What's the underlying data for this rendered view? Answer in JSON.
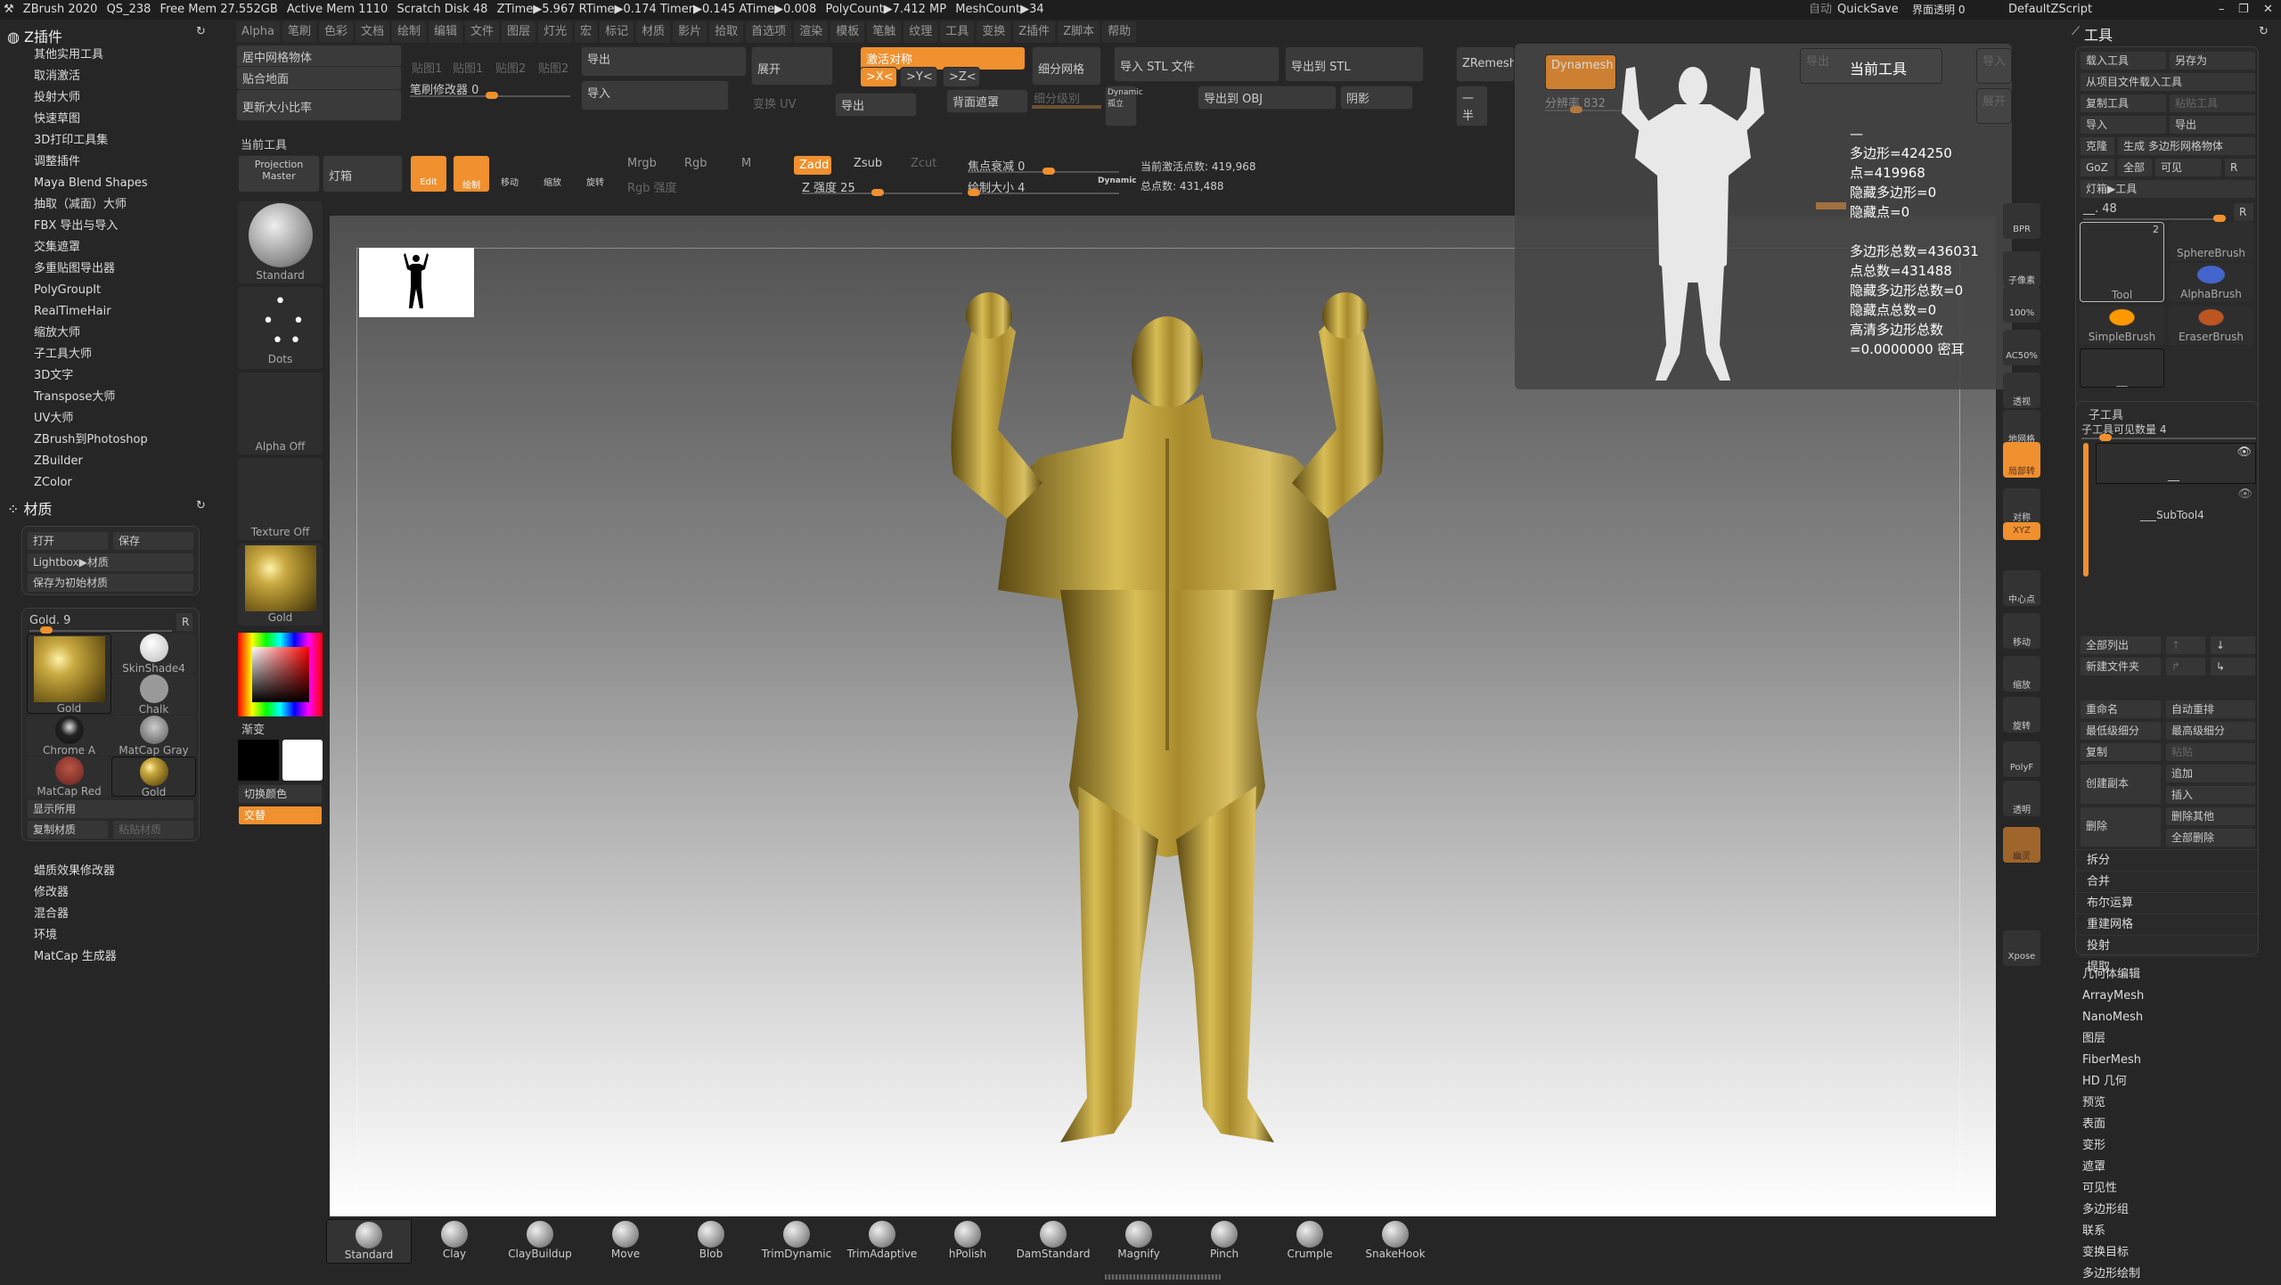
{
  "titlebar": {
    "app": "ZBrush 2020",
    "project": "QS_238",
    "free_mem": "Free Mem 27.552GB",
    "active_mem": "Active Mem 1110",
    "scratch": "Scratch Disk 48",
    "ztime": "ZTime▶5.967 RTime▶0.174 Timer▶0.145 ATime▶0.008",
    "polycount": "PolyCount▶7.412 MP",
    "meshcount": "MeshCount▶34",
    "auto": "自动",
    "quicksave": "QuickSave",
    "ui_opacity": "界面透明 0",
    "script": "DefaultZScript"
  },
  "menu": [
    "Alpha",
    "笔刷",
    "色彩",
    "文档",
    "绘制",
    "编辑",
    "文件",
    "图层",
    "灯光",
    "宏",
    "标记",
    "材质",
    "影片",
    "拾取",
    "首选项",
    "渲染",
    "模板",
    "笔触",
    "纹理",
    "工具",
    "变换",
    "Z插件",
    "Z脚本",
    "帮助"
  ],
  "plugins": {
    "title": "Z插件",
    "items": [
      "其他实用工具",
      "取消激活",
      "投射大师",
      "快速草图",
      "3D打印工具集",
      "调整插件",
      "Maya Blend Shapes",
      "抽取（减面）大师",
      "FBX 导出与导入",
      "交集遮罩",
      "多重贴图导出器",
      "PolyGroupIt",
      "RealTimeHair",
      "缩放大师",
      "子工具大师",
      "3D文字",
      "Transpose大师",
      "UV大师",
      "ZBrush到Photoshop",
      "ZBuilder",
      "ZColor"
    ]
  },
  "material": {
    "title": "材质",
    "open": "打开",
    "save": "保存",
    "lightbox": "Lightbox▶材质",
    "save_startup": "保存为初始材质",
    "slider": "Gold. 9",
    "r": "R",
    "items": [
      "Gold",
      "SkinShade4",
      "Chalk",
      "Chrome A",
      "MatCap Gray",
      "MatCap Red Wax",
      "Gold"
    ],
    "show_used": "显示所用",
    "copy": "复制材质",
    "paste": "粘贴材质",
    "sub": [
      "蜡质效果修改器",
      "修改器",
      "混合器",
      "环境",
      "MatCap 生成器"
    ]
  },
  "toolcol": {
    "brush": "Standard",
    "stroke": "Dots",
    "alpha": "Alpha Off",
    "texture": "Texture Off",
    "material": "Gold",
    "gradient": "渐变",
    "switch": "切换颜色",
    "alternate": "交替"
  },
  "top": {
    "center_mesh": "居中网格物体",
    "ground": "贴合地面",
    "update_scale": "更新大小比率",
    "maps": [
      "贴图1",
      "贴图1",
      "贴图2",
      "贴图2"
    ],
    "brush_mod": "笔刷修改器 0",
    "export": "导出",
    "import": "导入",
    "unwrap": "展开",
    "uv": "变换 UV",
    "export2": "导出",
    "sym": "激活对称",
    "x": ">X<",
    "y": ">Y<",
    "z": ">Z<",
    "backface": "背面遮罩",
    "divide": "细分网格",
    "sdiv": "细分级别",
    "dynamic": "Dynamic",
    "solo": "孤立",
    "import_stl": "导入 STL 文件",
    "export_stl": "导出到 STL",
    "export_obj": "导出到 OBJ",
    "shadow": "阴影",
    "zremesher": "ZRemesher",
    "half": "一半",
    "dynamesh": "Dynamesh",
    "resolution": "分辨率 832",
    "current_tool": "当前工具"
  },
  "shelf2": {
    "projection": "Projection Master",
    "lightbox": "灯箱",
    "edit": "Edit",
    "draw": "绘制",
    "move": "移动",
    "scale": "缩放",
    "rotate": "旋转",
    "mrgb": "Mrgb",
    "rgb": "Rgb",
    "m": "M",
    "rgb_int": "Rgb 强度",
    "zadd": "Zadd",
    "zsub": "Zsub",
    "zcut": "Zcut",
    "z_int": "Z 强度 25",
    "focal": "焦点衰减 0",
    "draw_size": "绘制大小 4",
    "dynamic": "Dynamic",
    "active_pts": "当前激活点数: 419,968",
    "total_pts": "总点数: 431,488"
  },
  "nav": {
    "export": "导出",
    "import": "导入",
    "unwrap": "展开",
    "title": "当前工具",
    "dash": "—",
    "stats": [
      "多边形=424250",
      "点=419968",
      "隐藏多边形=0",
      "隐藏点=0"
    ],
    "totals": [
      "多边形总数=436031",
      "点总数=431488",
      "隐藏多边形总数=0",
      "隐藏点总数=0",
      "高清多边形总数=0.0000000 密耳"
    ]
  },
  "vstrip": [
    "BPR",
    "子像素",
    "100%",
    "AC50%",
    "透视",
    "地网格",
    "局部转",
    "对称",
    "XYZ",
    "中心点",
    "移动",
    "缩放",
    "旋转",
    "PolyF",
    "透明",
    "幽灵",
    "Xpose"
  ],
  "tool": {
    "title": "工具",
    "load": "载入工具",
    "saveas": "另存为",
    "load_project": "从项目文件载入工具",
    "copy": "复制工具",
    "paste": "粘贴工具",
    "import": "导入",
    "export": "导出",
    "clone": "克隆",
    "make_poly": "生成 多边形网格物体",
    "goz": "GoZ",
    "all": "全部",
    "visible": "可见",
    "r": "R",
    "lightbox": "灯箱▶工具",
    "slider": "__. 48",
    "thumbs": [
      "Tool",
      "SphereBrush",
      "AlphaBrush",
      "SimpleBrush",
      "EraserBrush",
      "__"
    ],
    "count": "2"
  },
  "subtool": {
    "title": "子工具",
    "visible_count": "子工具可见数量 4",
    "items": [
      "__",
      "___SubTool4"
    ],
    "list_all": "全部列出",
    "new_folder": "新建文件夹",
    "rename": "重命名",
    "autoreorder": "自动重排",
    "lowest": "最低级细分",
    "highest": "最高级细分",
    "dup": "复制",
    "paste": "粘贴",
    "copy": "创建副本",
    "append": "追加",
    "insert": "插入",
    "delete": "删除",
    "del_other": "删除其他",
    "del_all": "全部删除",
    "rows": [
      "拆分",
      "合并",
      "布尔运算",
      "重建网格",
      "投射",
      "提取"
    ]
  },
  "toolmenus": [
    "几何体编辑",
    "ArrayMesh",
    "NanoMesh",
    "图层",
    "FiberMesh",
    "HD 几何",
    "预览",
    "表面",
    "变形",
    "遮罩",
    "可见性",
    "多边形组",
    "联系",
    "变换目标",
    "多边形绘制"
  ],
  "brushes": [
    "Standard",
    "Clay",
    "ClayBuildup",
    "Move",
    "Blob",
    "TrimDynamic",
    "TrimAdaptive",
    "hPolish",
    "DamStandard",
    "Magnify",
    "Pinch",
    "Crumple",
    "SnakeHook"
  ],
  "colors": {
    "accent": "#f0902e",
    "gold": "#c9a941"
  }
}
